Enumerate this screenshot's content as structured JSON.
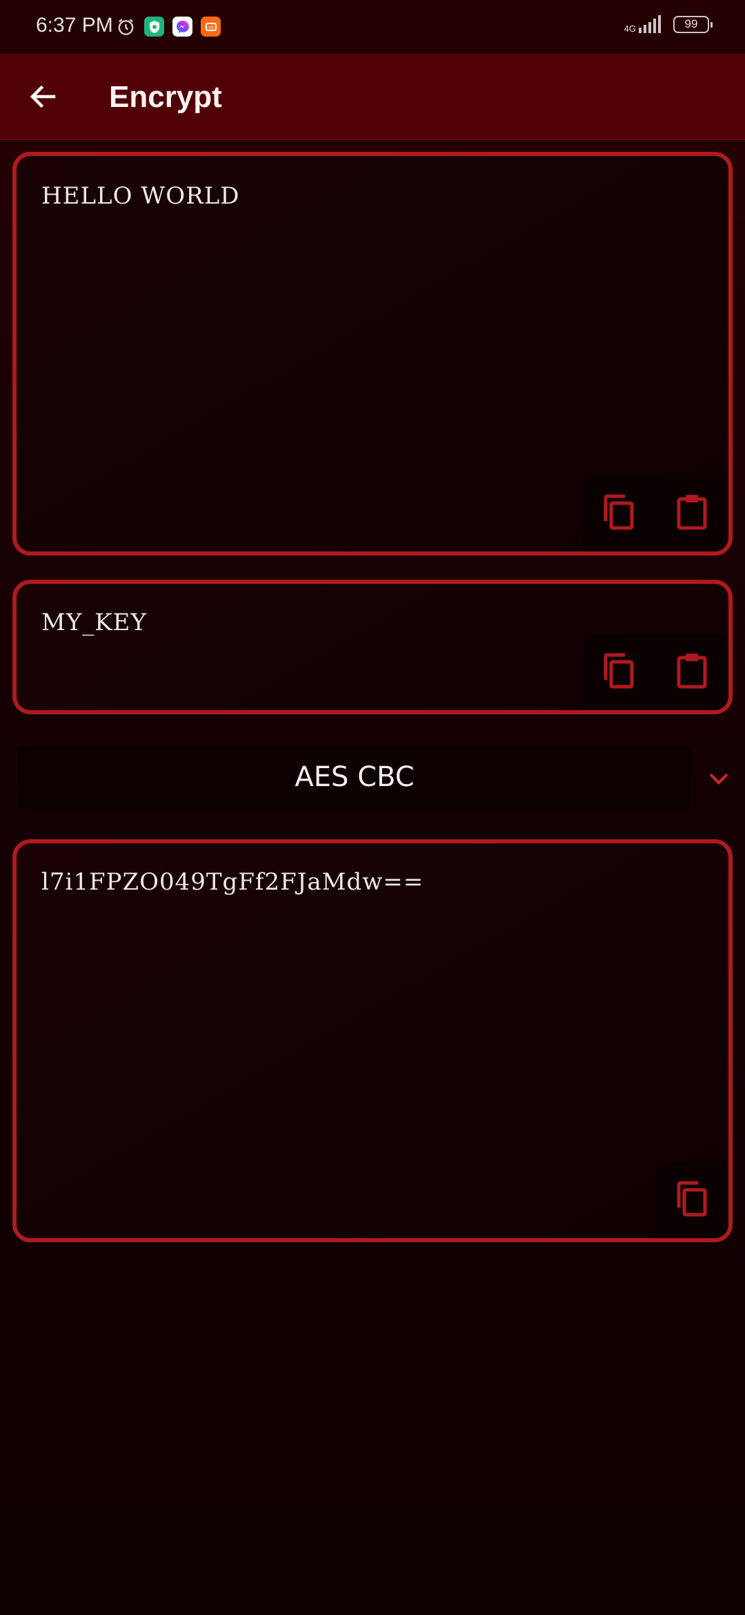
{
  "status_bar": {
    "time": "6:37 PM",
    "network": "4G",
    "battery": "99",
    "icons": [
      "alarm-icon",
      "vpn-shield-icon",
      "messenger-icon",
      "mi-app-icon"
    ]
  },
  "app_bar": {
    "title": "Encrypt",
    "back_icon": "arrow-left-icon"
  },
  "input_panel": {
    "value": "HELLO WORLD",
    "actions": [
      "copy-icon",
      "paste-icon"
    ]
  },
  "key_panel": {
    "value": "MY_KEY",
    "actions": [
      "copy-icon",
      "paste-icon"
    ]
  },
  "algorithm_select": {
    "selected": "AES CBC",
    "icon": "chevron-down-icon"
  },
  "output_panel": {
    "value": "l7i1FPZO049TgFf2FJaMdw==",
    "actions": [
      "copy-icon"
    ]
  },
  "colors": {
    "accent": "#b01a1e",
    "app_bar": "#510105",
    "background": "#120003"
  }
}
